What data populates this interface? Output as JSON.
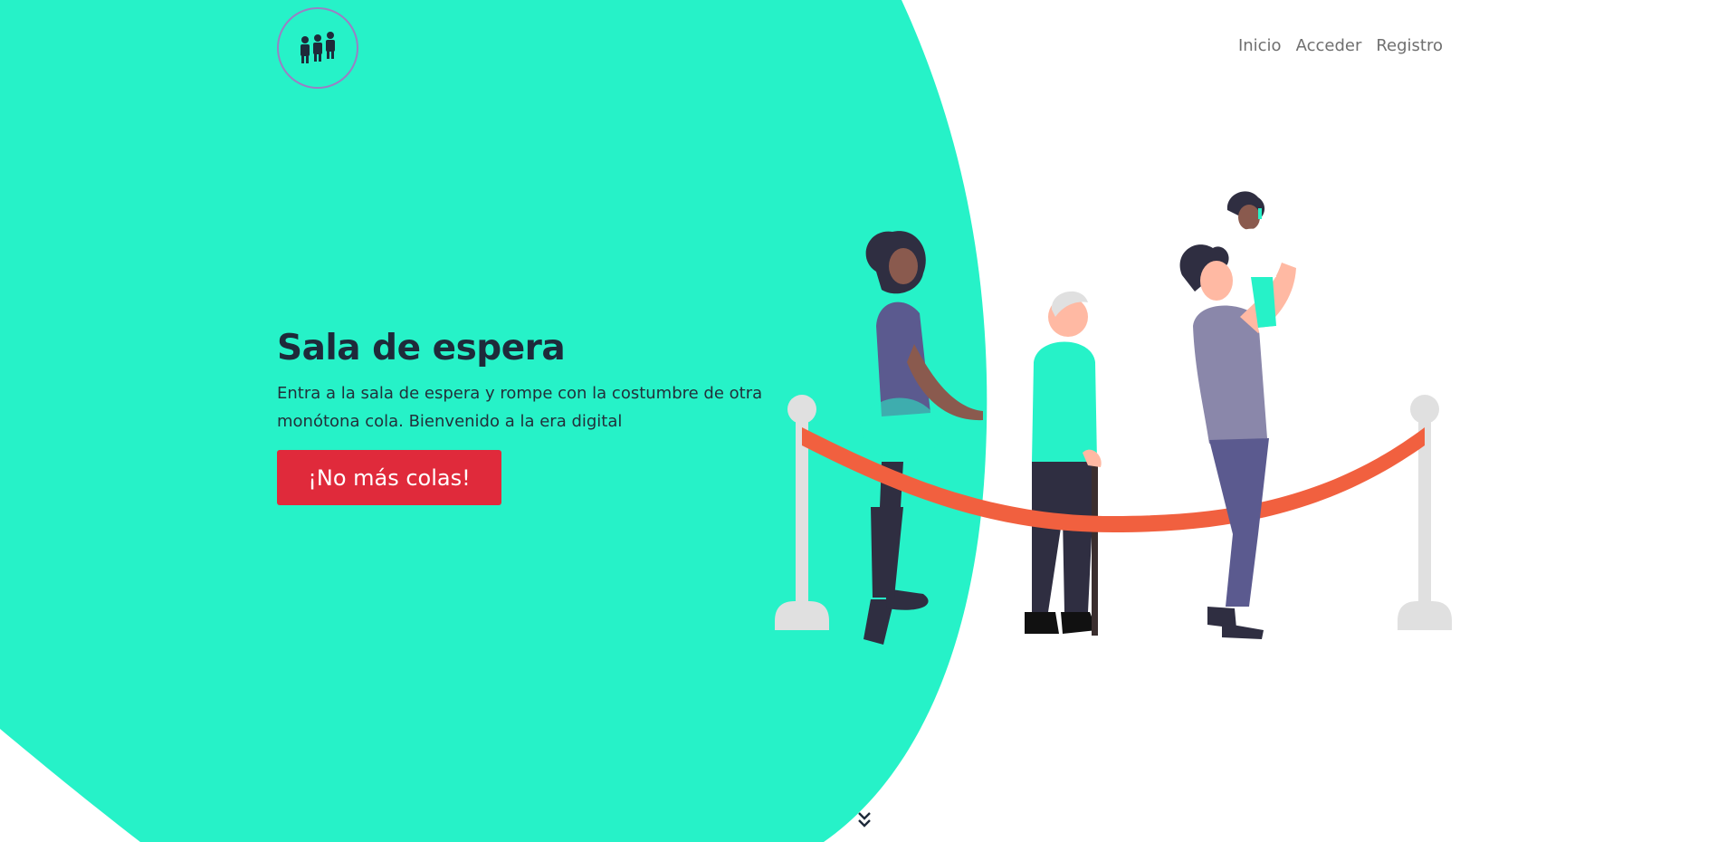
{
  "header": {
    "logo_icon": "people-queue-icon",
    "nav": [
      {
        "label": "Inicio"
      },
      {
        "label": "Acceder"
      },
      {
        "label": "Registro"
      }
    ]
  },
  "hero": {
    "title": "Sala de espera",
    "description": "Entra a la sala de espera y rompe con la costumbre de otra monótona cola. Bienvenido a la era digital",
    "cta_label": "¡No más colas!"
  },
  "illustration_icon": "people-waiting-queue-illustration",
  "scroll_icon": "double-chevron-down-icon",
  "colors": {
    "accent": "#26f2c8",
    "cta": "#e02a3b",
    "title": "#1e2a3a",
    "nav": "#6f6f6f",
    "rope": "#f1603f"
  }
}
